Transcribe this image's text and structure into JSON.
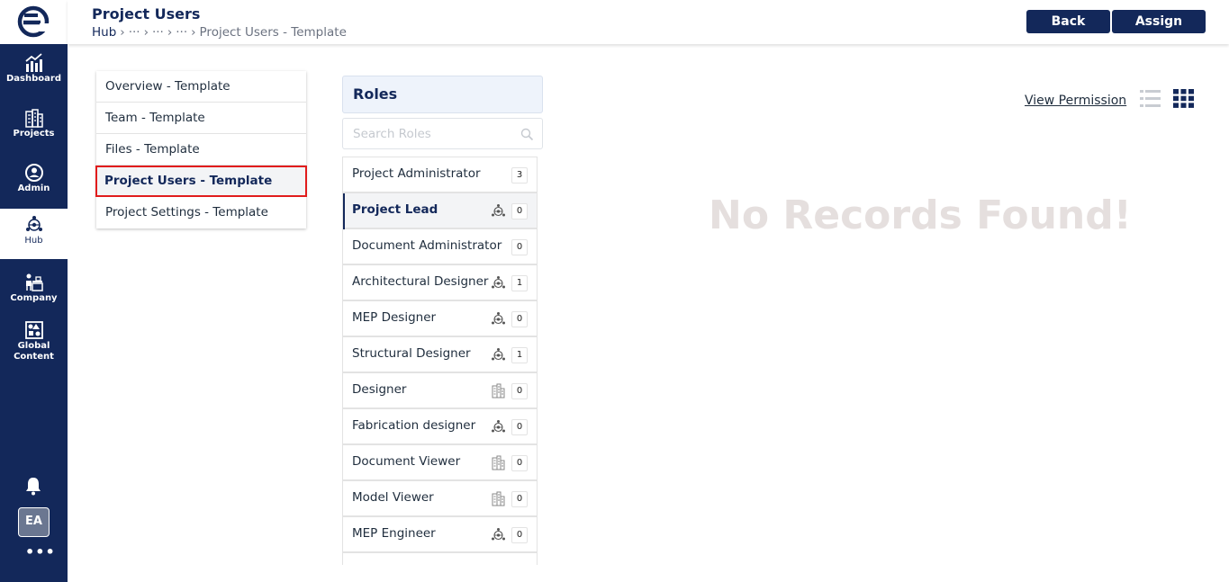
{
  "header": {
    "title": "Project Users",
    "breadcrumb": {
      "root": "Hub",
      "ellipsis": "···",
      "current": "Project Users - Template"
    },
    "back_label": "Back",
    "assign_label": "Assign"
  },
  "sidebar": {
    "items": [
      {
        "label": "Dashboard",
        "icon": "dashboard-icon"
      },
      {
        "label": "Projects",
        "icon": "projects-icon"
      },
      {
        "label": "Admin",
        "icon": "admin-icon"
      },
      {
        "label": "Hub",
        "icon": "hub-icon",
        "active": true
      },
      {
        "label": "Company",
        "icon": "company-icon"
      },
      {
        "label": "Global\nContent",
        "icon": "global-content-icon"
      }
    ],
    "avatar": "EA",
    "more": "•••"
  },
  "menu": {
    "items": [
      "Overview - Template",
      "Team - Template",
      "Files - Template",
      "Project Users - Template",
      "Project Settings - Template"
    ],
    "selected": "Project Users - Template"
  },
  "roles": {
    "title": "Roles",
    "search_placeholder": "Search Roles",
    "items": [
      {
        "name": "Project Administrator",
        "count": "3",
        "icon": ""
      },
      {
        "name": "Project Lead",
        "count": "0",
        "icon": "hub-icon",
        "active": true
      },
      {
        "name": "Document Administrator",
        "count": "0",
        "icon": ""
      },
      {
        "name": "Architectural Designer",
        "count": "1",
        "icon": "hub-icon"
      },
      {
        "name": "MEP Designer",
        "count": "0",
        "icon": "hub-icon"
      },
      {
        "name": "Structural Designer",
        "count": "1",
        "icon": "hub-icon"
      },
      {
        "name": "Designer",
        "count": "0",
        "icon": "building-icon"
      },
      {
        "name": "Fabrication designer",
        "count": "0",
        "icon": "hub-icon"
      },
      {
        "name": "Document Viewer",
        "count": "0",
        "icon": "building-icon"
      },
      {
        "name": "Model Viewer",
        "count": "0",
        "icon": "building-icon"
      },
      {
        "name": "MEP Engineer",
        "count": "0",
        "icon": "hub-icon"
      }
    ]
  },
  "main": {
    "view_permission": "View Permission",
    "empty_message": "No Records Found!"
  },
  "colors": {
    "brand": "#13285a",
    "highlight": "#e11c1c",
    "empty_text": "#e5dfde"
  }
}
